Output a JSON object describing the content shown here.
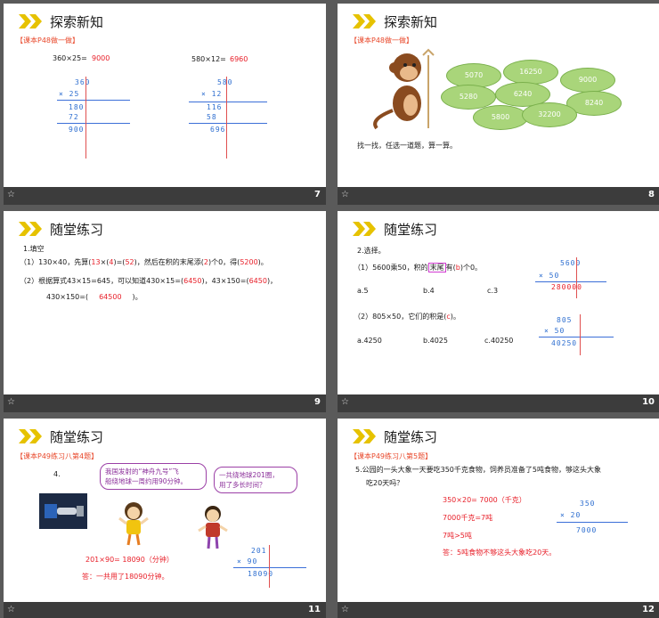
{
  "slides": [
    {
      "number": "7",
      "title": "探索新知",
      "tag": "【课本P48做一做】",
      "problem1": {
        "expr": "360×25=",
        "answer": "9000",
        "rows": [
          "360",
          "× 25",
          "180",
          "72",
          "900"
        ]
      },
      "problem2": {
        "expr": "580×12=",
        "answer": "6960",
        "rows": [
          "580",
          "× 12",
          "116",
          "58",
          "696"
        ]
      },
      "zero_mark": "0"
    },
    {
      "number": "8",
      "title": "探索新知",
      "tag": "【课本P48做一做】",
      "leaves": [
        "5070",
        "16250",
        "9000",
        "5280",
        "6240",
        "8240",
        "5800",
        "32200"
      ],
      "instruction": "找一找，任选一道题，算一算。"
    },
    {
      "number": "9",
      "title": "随堂练习",
      "heading": "1.填空",
      "line1_a": "（1）130×40，先算(",
      "line1_b": "13",
      "line1_c": "×(",
      "line1_d": "4",
      "line1_e": ")=(",
      "line1_f": "52",
      "line1_g": ")，然后在积的末尾添(",
      "line1_h": "2",
      "line1_i": ")个0，得(",
      "line1_j": "5200",
      "line1_k": ")。",
      "line2_a": "（2）根据算式43×15=645，可以知道430×15=(",
      "line2_b": "6450",
      "line2_c": ")，43×150=(",
      "line2_d": "6450",
      "line2_e": ")，",
      "line3_a": "430×150=(",
      "line3_b": "64500",
      "line3_c": ")。"
    },
    {
      "number": "10",
      "title": "随堂练习",
      "heading": "2.选择。",
      "q1_a": "（1）5600乘50，积的",
      "q1_b": "末尾",
      "q1_c": "有(",
      "q1_d": "b",
      "q1_e": ")个0。",
      "q1_options": [
        "a.5",
        "b.4",
        "c.3"
      ],
      "q1_calc": [
        "5600",
        "× 50",
        "280000"
      ],
      "q2_a": "（2）805×50，它们的积是(",
      "q2_b": "c",
      "q2_c": ")。",
      "q2_options": [
        "a.4250",
        "b.4025",
        "c.40250"
      ],
      "q2_calc": [
        "805",
        "× 50",
        "40250"
      ]
    },
    {
      "number": "11",
      "title": "随堂练习",
      "tag": "【课本P49练习八第4题】",
      "qnum": "4.",
      "bubble1_a": "我国发射的“神舟九号”飞",
      "bubble1_b": "船绕地球一周约用90分钟。",
      "bubble2_a": "一共绕地球201圈，",
      "bubble2_b": "用了多长时间？",
      "calc": [
        "201",
        "× 90",
        "18090"
      ],
      "equation": "201×90= 18090（分钟）",
      "answer": "答：一共用了18090分钟。"
    },
    {
      "number": "12",
      "title": "随堂练习",
      "tag": "【课本P49练习八第5题】",
      "question_a": "5.公园的一头大象一天要吃350千克食物，饲养员准备了5吨食物，够这头大象",
      "question_b": "吃20天吗？",
      "step1": "350×20= 7000（千克）",
      "step2": "7000千克=7吨",
      "step3": "7吨>5吨",
      "answer": "答：5吨食物不够这头大象吃20天。",
      "calc": [
        "350",
        "× 20",
        "7000"
      ]
    }
  ],
  "colors": {
    "accent_red": "#e8202a",
    "title_chevron": "#e6c200",
    "leaf_green": "#a9d57a",
    "bar": "#3c3c3c"
  }
}
